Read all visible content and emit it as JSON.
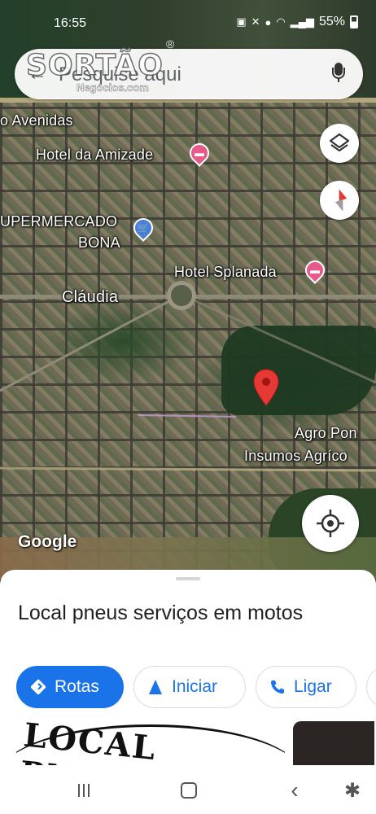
{
  "status_bar": {
    "time": "16:55",
    "battery": "55%"
  },
  "watermark": {
    "name": "SORTÃO",
    "subtitle": "Negócios.com",
    "registered": "®"
  },
  "search": {
    "placeholder": "Pesquise aqui"
  },
  "map": {
    "labels": {
      "avenidas": "o Avenidas",
      "hotel_amizade": "Hotel da Amizade",
      "supermercado_line1": "UPERMERCADO",
      "supermercado_line2": "BONA",
      "hotel_splanada": "Hotel Splanada",
      "claudia": "Cláudia",
      "agro_line1": "Agro Pon",
      "agro_line2": "Insumos Agríco"
    },
    "attribution": "Google"
  },
  "place": {
    "name": "Local pneus serviços em motos",
    "actions": {
      "directions": "Rotas",
      "start": "Iniciar",
      "call": "Ligar"
    },
    "photo_text": "LOCAL PNEUS"
  },
  "colors": {
    "accent": "#1a73e8",
    "pin_red": "#e53935",
    "hotel_pin": "#e85a8a",
    "shop_pin": "#4a7fd8"
  },
  "icons": [
    "back-arrow-icon",
    "mic-icon",
    "layers-icon",
    "compass-icon",
    "my-location-icon",
    "directions-icon",
    "navigation-icon",
    "phone-icon",
    "recent-apps-icon",
    "home-icon",
    "back-icon",
    "accessibility-icon"
  ]
}
